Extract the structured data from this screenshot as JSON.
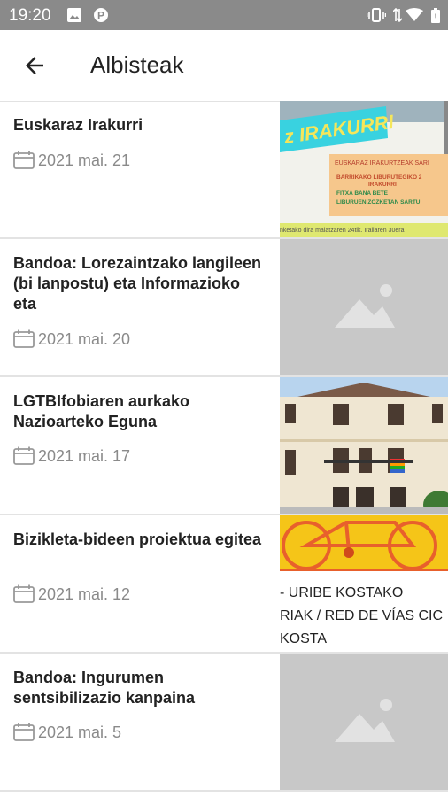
{
  "status": {
    "time": "19:20"
  },
  "appbar": {
    "title": "Albisteak"
  },
  "items": [
    {
      "title": "Euskaraz Irakurri",
      "date": "2021 mai. 21"
    },
    {
      "title": "Bandoa: Lorezaintzako langileen (bi lanpostu) eta Informazioko eta",
      "date": "2021 mai. 20"
    },
    {
      "title": "LGTBIfobiaren aurkako Nazioarteko Eguna",
      "date": "2021 mai. 17"
    },
    {
      "title": "Bizikleta-bideen proiektua egitea",
      "date": "2021 mai. 12"
    },
    {
      "title": "Bandoa: Ingurumen sentsibilizazio kanpaina",
      "date": "2021 mai. 5"
    }
  ],
  "thumbs": {
    "poster_title": "z IRAKURRI",
    "poster_heading": "EUSKARAZ IRAKURTZEAK SARI",
    "poster_line1": "BARRIKAKO LIBURUTEGIKO 2",
    "poster_line1b": "IRAKURRI",
    "poster_line2": "FITXA BANA BETE",
    "poster_line3": "LIBURUEN ZOZKETAN SARTU",
    "poster_footer": "nketako dira maiatzaren 24tik. Irailaren 30era",
    "bike_line1": "- URIBE KOSTAKO",
    "bike_line2": "RIAK / RED DE VÍAS CIC",
    "bike_line3": "KOSTA"
  }
}
